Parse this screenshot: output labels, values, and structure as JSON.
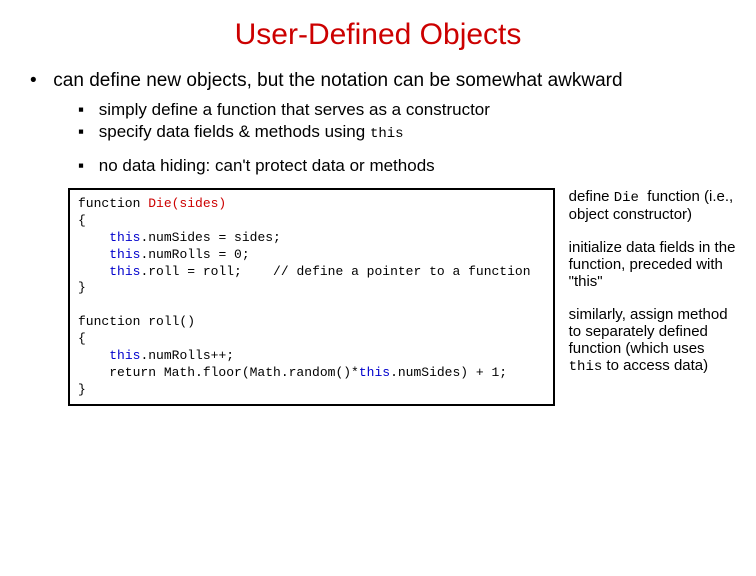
{
  "title": "User-Defined Objects",
  "mainBullet": "can define new objects, but the notation can be somewhat awkward",
  "subBullets": {
    "b1_a": "simply define a function that serves as a constructor",
    "b1_b_pre": "specify data fields & methods using ",
    "b1_b_code": "this",
    "b2": "no data hiding: can't protect data or methods"
  },
  "code": {
    "l1a": "function ",
    "l1b": "Die(sides)",
    "l2": "{",
    "l3a": "    ",
    "l3b": "this",
    "l3c": ".numSides = sides;",
    "l4a": "    ",
    "l4b": "this",
    "l4c": ".numRolls = 0;",
    "l5a": "    ",
    "l5b": "this",
    "l5c": ".roll = roll;    // define a pointer to a function",
    "l6": "}",
    "l7": "",
    "l8": "function roll()",
    "l9": "{",
    "l10a": "    ",
    "l10b": "this",
    "l10c": ".numRolls++;",
    "l11a": "    return Math.floor(Math.random()*",
    "l11b": "this",
    "l11c": ".numSides) + 1;",
    "l12": "}"
  },
  "notes": {
    "n1a": "define ",
    "n1b": "Die ",
    "n1c": "function (i.e., object constructor)",
    "n2": "initialize data fields in the function, preceded with \"this\"",
    "n3a": "similarly, assign method to separately defined function (which uses ",
    "n3b": "this",
    "n3c": " to access data)"
  }
}
